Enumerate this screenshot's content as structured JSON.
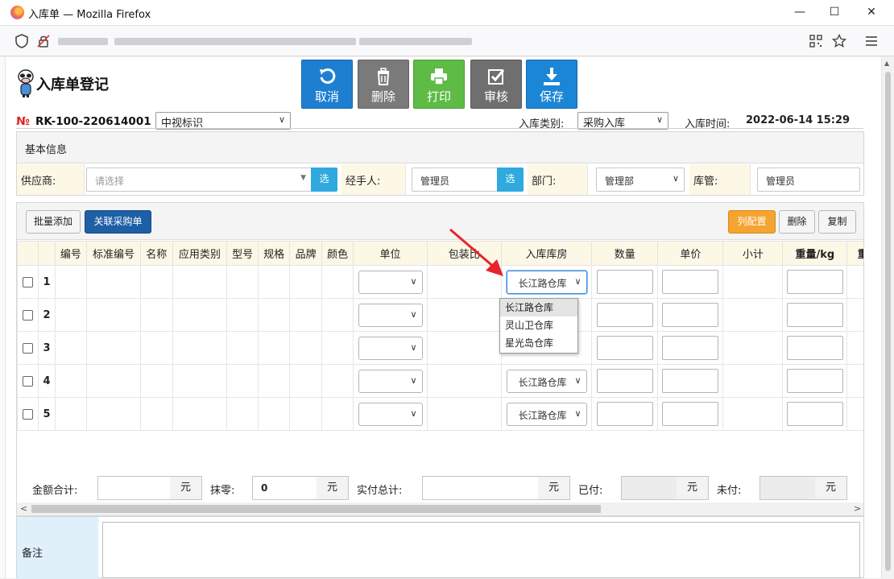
{
  "window": {
    "title": "入库单 — Mozilla Firefox",
    "minimize": "—",
    "maximize": "☐",
    "close": "✕"
  },
  "form": {
    "title": "入库单登记",
    "no_mark": "№",
    "order_no": "RK-100-220614001",
    "company": "中视标识",
    "inbound_type_label": "入库类别:",
    "inbound_type": "采购入库",
    "inbound_time_label": "入库时间:",
    "inbound_time": "2022-06-14 15:29"
  },
  "actions": {
    "cancel": "取消",
    "delete": "删除",
    "print": "打印",
    "review": "审核",
    "save": "保存"
  },
  "basic_info": {
    "title": "基本信息",
    "supplier_label": "供应商:",
    "supplier_placeholder": "请选择",
    "pick": "选",
    "handler_label": "经手人:",
    "handler": "管理员",
    "dept_label": "部门:",
    "dept": "管理部",
    "keeper_label": "库管:",
    "keeper": "管理员"
  },
  "grid_toolbar": {
    "batch_add": "批量添加",
    "link_po": "关联采购单",
    "col_config": "列配置",
    "delete": "删除",
    "copy": "复制"
  },
  "grid": {
    "columns": [
      "编号",
      "标准编号",
      "名称",
      "应用类别",
      "型号",
      "规格",
      "品牌",
      "颜色",
      "单位",
      "包装比",
      "入库库房",
      "数量",
      "单价",
      "小计",
      "重量/kg",
      "重"
    ],
    "rows": [
      {
        "num": "1",
        "warehouse": "长江路仓库"
      },
      {
        "num": "2",
        "warehouse": ""
      },
      {
        "num": "3",
        "warehouse": ""
      },
      {
        "num": "4",
        "warehouse": "长江路仓库"
      },
      {
        "num": "5",
        "warehouse": "长江路仓库"
      }
    ],
    "warehouse_options": [
      "长江路仓库",
      "灵山卫仓库",
      "星光岛仓库"
    ]
  },
  "totals": {
    "amount_label": "金额合计:",
    "rounding_label": "抹零:",
    "rounding_value": "0",
    "actual_label": "实付总计:",
    "paid_label": "已付:",
    "unpaid_label": "未付:",
    "unit": "元"
  },
  "remarks": {
    "label": "备注"
  },
  "colors": {
    "cancel_btn": "#1e7fd1",
    "delete_btn": "#7a7a7a",
    "print_btn": "#5ebb46",
    "review_btn": "#6f6f6f",
    "save_btn": "#1c86d6",
    "col_config_btn": "#f5a430",
    "link_po_btn": "#1e5fa6",
    "label_bg": "#fdf7e6",
    "arrow": "#e8242b"
  }
}
